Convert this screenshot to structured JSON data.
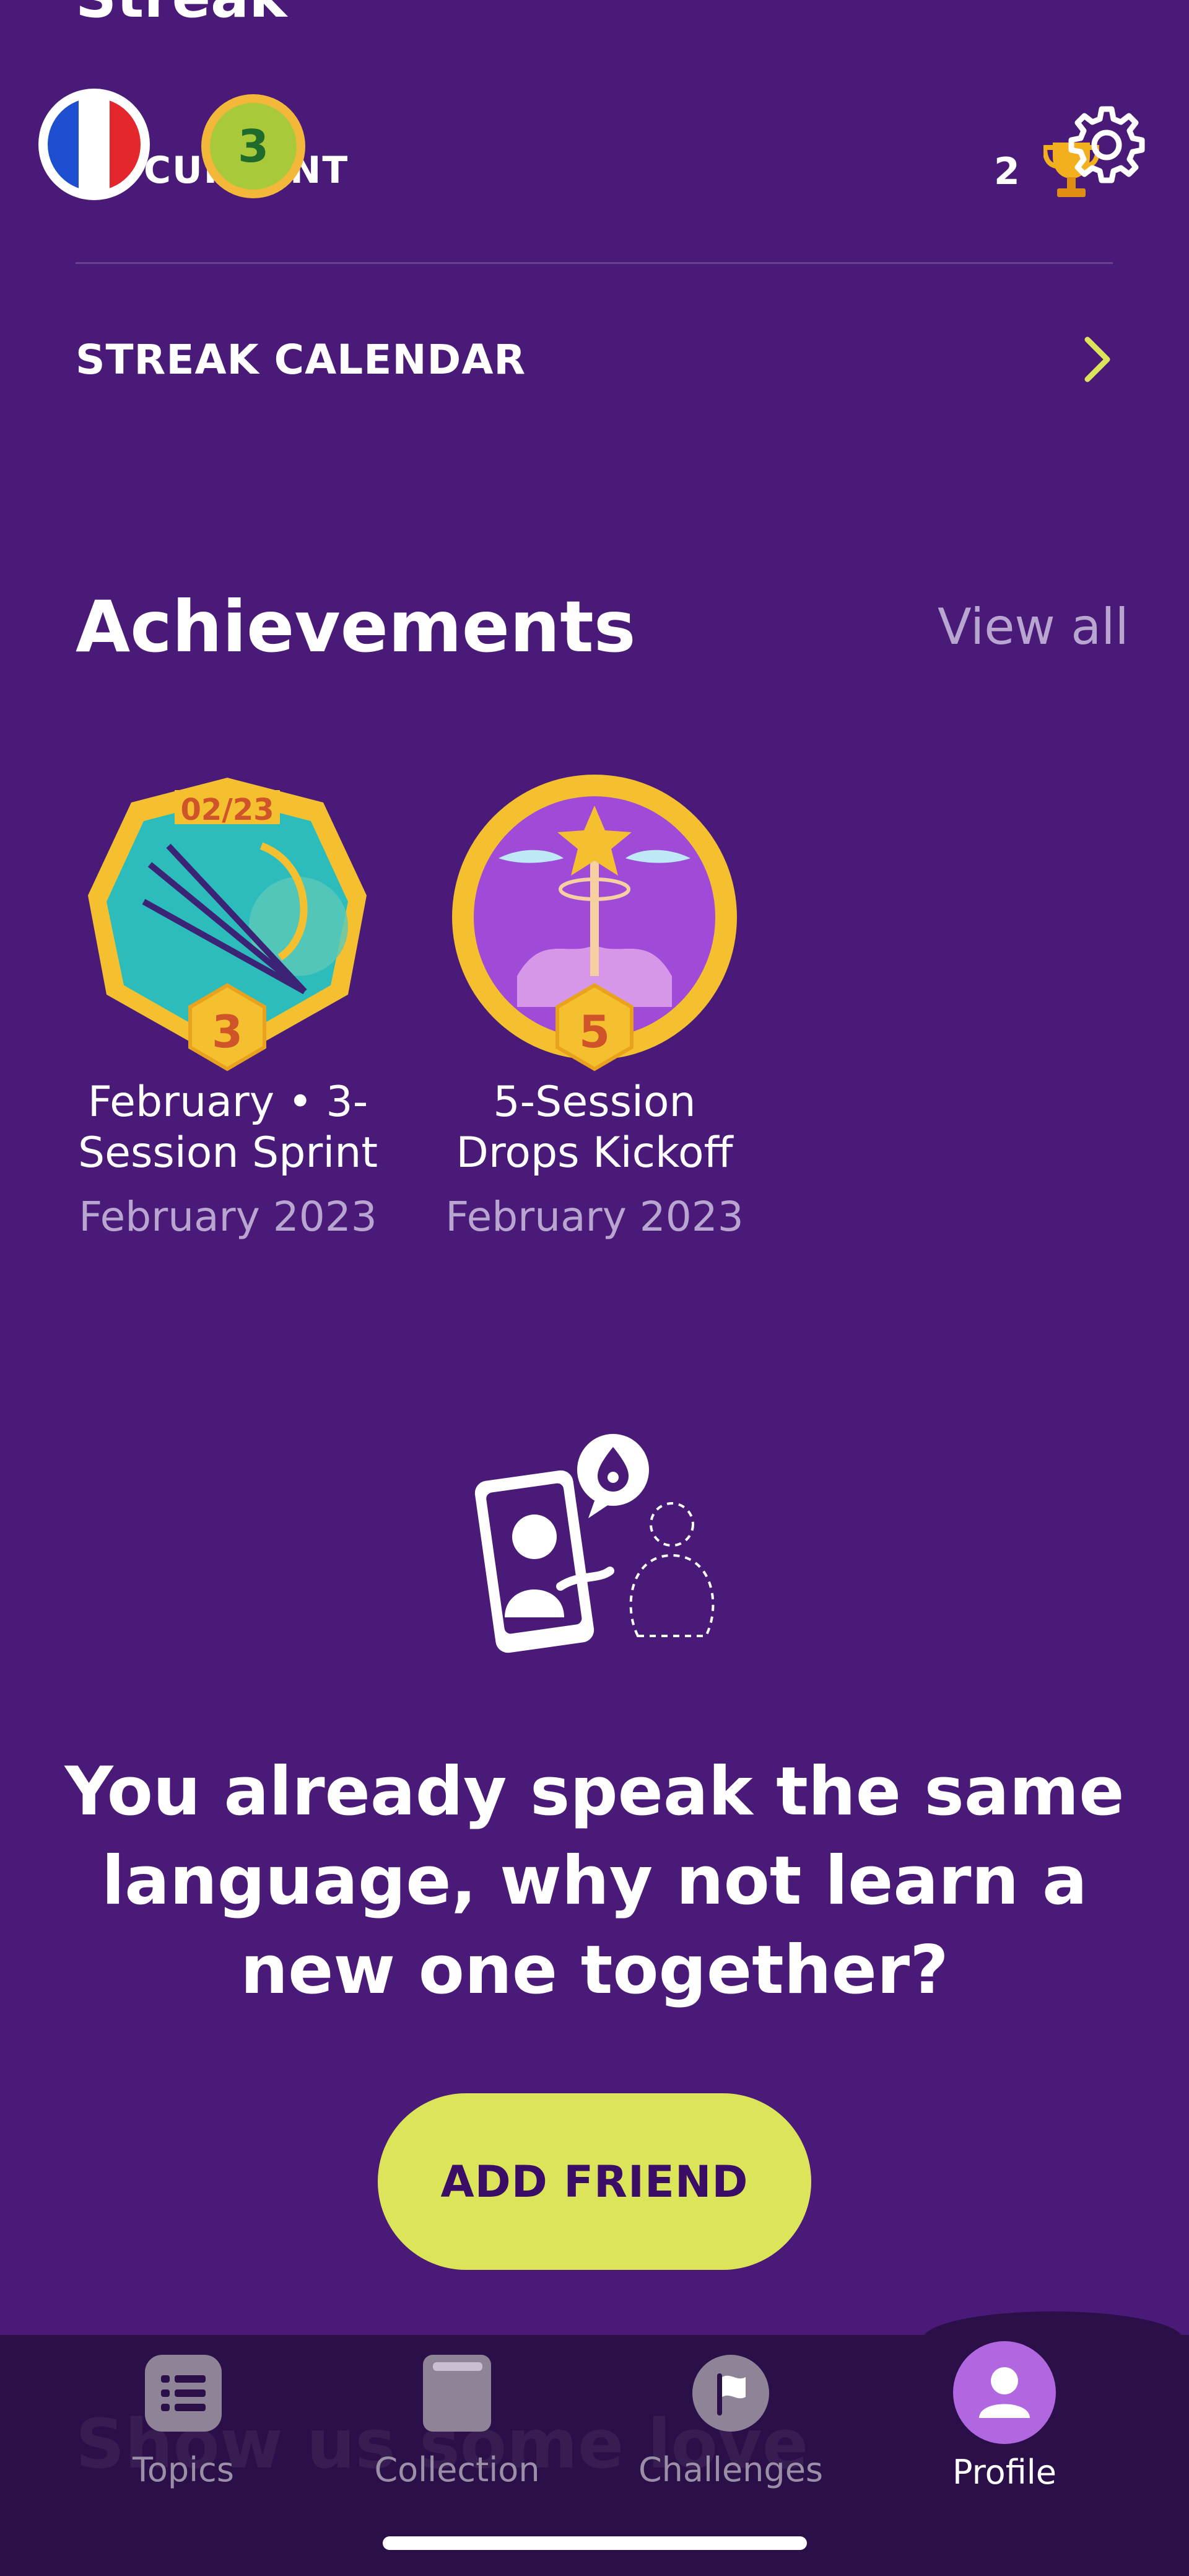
{
  "header": {
    "section_title": "Streak",
    "current_label": "CURRENT",
    "streak_count": "3",
    "trophy_count": "2",
    "flag_icon": "france-flag-icon",
    "settings_icon": "gear-icon"
  },
  "streak_calendar": {
    "label": "STREAK CALENDAR"
  },
  "achievements": {
    "title": "Achievements",
    "view_all": "View all",
    "items": [
      {
        "line1": "February • 3-",
        "line2": "Session Sprint",
        "date": "February 2023",
        "badge_date": "02/23",
        "level": "3"
      },
      {
        "line1": "5-Session",
        "line2": "Drops Kickoff",
        "date": "February 2023",
        "level": "5"
      }
    ]
  },
  "invite": {
    "line1": "You already speak the same",
    "line2": "language, why not learn a",
    "line3": "new one together?",
    "button": "ADD FRIEND"
  },
  "ghost_text": "Show us some love",
  "nav": {
    "items": [
      {
        "label": "Topics",
        "icon": "list-icon"
      },
      {
        "label": "Collection",
        "icon": "book-icon"
      },
      {
        "label": "Challenges",
        "icon": "flag-icon"
      },
      {
        "label": "Profile",
        "icon": "user-icon"
      }
    ]
  },
  "colors": {
    "background": "#4a1a78",
    "accent": "#dce55a",
    "nav_background": "#2b0f48",
    "active_tab": "#b067e0"
  }
}
